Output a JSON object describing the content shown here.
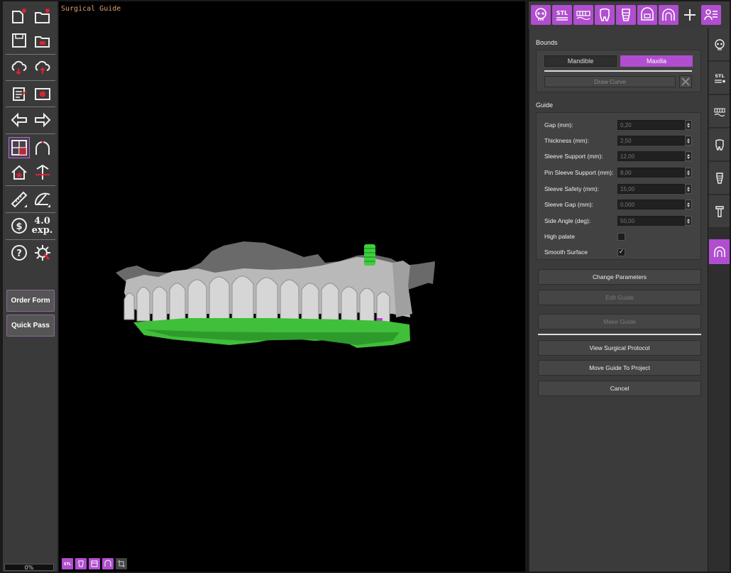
{
  "viewport": {
    "title": "Surgical Guide"
  },
  "left_toolbar": {
    "exp_version": "4.0",
    "exp_suffix": "exp.",
    "order_form_label": "Order Form",
    "quick_pass_label": "Quick Pass",
    "progress": "0%"
  },
  "panel": {
    "bounds_title": "Bounds",
    "mandible_label": "Mandible",
    "maxilla_label": "Maxilla",
    "selected_bound": "Maxilla",
    "draw_curve_label": "Draw Curve",
    "guide_title": "Guide",
    "params": [
      {
        "label": "Gap (mm):",
        "value": "0,20"
      },
      {
        "label": "Thickness (mm):",
        "value": "2,50"
      },
      {
        "label": "Sleeve Support (mm):",
        "value": "12,00"
      },
      {
        "label": "Pin Sleeve Support (mm):",
        "value": "8,00"
      },
      {
        "label": "Sleeve Safety (mm):",
        "value": "15,00"
      },
      {
        "label": "Sleeve Gap (mm):",
        "value": "0,000"
      },
      {
        "label": "Side Angle (deg):",
        "value": "50,00"
      }
    ],
    "high_palate_label": "High palate",
    "high_palate_checked": false,
    "smooth_surface_label": "Smooth Surface",
    "smooth_surface_checked": true,
    "change_parameters_label": "Change Parameters",
    "edit_guide_label": "Edit Guide",
    "make_guide_label": "Make Guide",
    "view_protocol_label": "View Surgical Protocol",
    "move_guide_label": "Move Guide To Project",
    "cancel_label": "Cancel"
  },
  "side_tabs": {
    "stl_label": "STL"
  },
  "top_tabs": {
    "stl_label": "STL"
  },
  "colors": {
    "accent": "#b04ecf",
    "panel_bg": "#3b3b3b",
    "viewport_bg": "#000000",
    "guide_green": "#3fbf3a"
  }
}
